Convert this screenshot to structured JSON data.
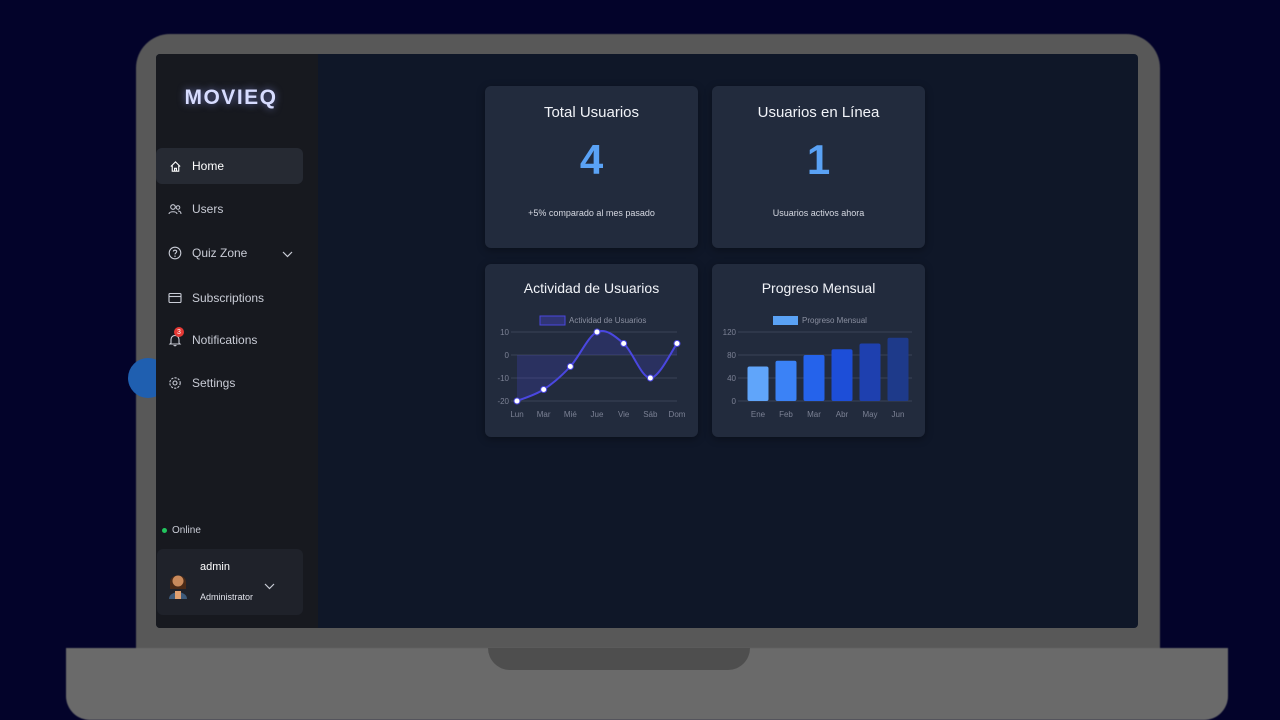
{
  "app": {
    "logo": "MOVIEQ"
  },
  "sidebar": {
    "items": [
      {
        "label": "Home",
        "icon": "home-icon",
        "active": true
      },
      {
        "label": "Users",
        "icon": "users-icon"
      },
      {
        "label": "Quiz Zone",
        "icon": "help-circle-icon",
        "has_chevron": true
      },
      {
        "label": "Subscriptions",
        "icon": "card-icon"
      },
      {
        "label": "Notifications",
        "icon": "bell-icon",
        "badge": "3"
      },
      {
        "label": "Settings",
        "icon": "gear-icon"
      }
    ],
    "status": "Online",
    "user": {
      "name": "admin",
      "role": "Administrator"
    }
  },
  "stats": {
    "total_users": {
      "title": "Total Usuarios",
      "value": "4",
      "sub": "+5% comparado al mes pasado"
    },
    "online_users": {
      "title": "Usuarios en Línea",
      "value": "1",
      "sub": "Usuarios activos ahora"
    }
  },
  "colors": {
    "accent": "#5aa2f5",
    "line": "#4a47e0",
    "online": "#22c55e",
    "badge": "#e53935"
  },
  "chart_data": [
    {
      "type": "line",
      "title": "Actividad de Usuarios",
      "categories": [
        "Lun",
        "Mar",
        "Mié",
        "Jue",
        "Vie",
        "Sáb",
        "Dom"
      ],
      "series": [
        {
          "name": "Actividad de Usuarios",
          "values": [
            -20,
            -15,
            -5,
            10,
            5,
            -10,
            5
          ]
        }
      ],
      "ylim": [
        -20,
        10
      ],
      "yticks": [
        "10",
        "0",
        "-10",
        "-20"
      ],
      "legend": "top",
      "grid": true
    },
    {
      "type": "bar",
      "title": "Progreso Mensual",
      "categories": [
        "Ene",
        "Feb",
        "Mar",
        "Abr",
        "May",
        "Jun"
      ],
      "series": [
        {
          "name": "Progreso Mensual",
          "values": [
            60,
            70,
            80,
            90,
            100,
            110
          ]
        }
      ],
      "ylim": [
        0,
        120
      ],
      "yticks": [
        "120",
        "80",
        "40",
        "0"
      ],
      "legend": "top",
      "grid": true
    }
  ]
}
